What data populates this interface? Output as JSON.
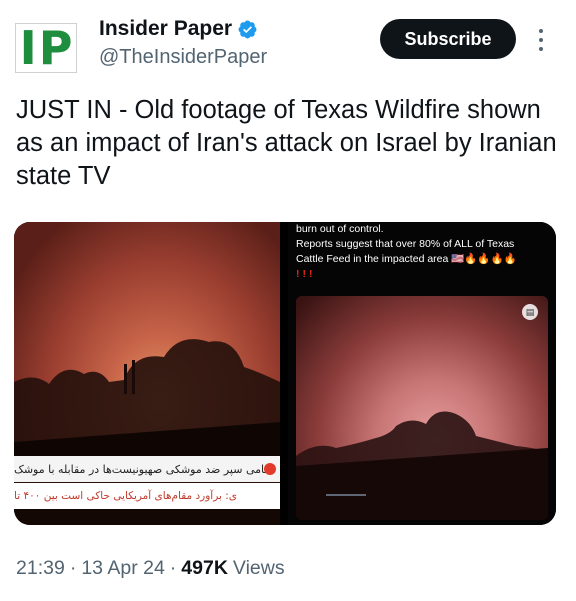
{
  "account": {
    "display_name": "Insider Paper",
    "handle": "@TheInsiderPaper",
    "logo_text": "IP",
    "verified": true
  },
  "header": {
    "subscribe_label": "Subscribe"
  },
  "tweet": {
    "text": "JUST IN - Old footage of Texas Wildfire shown as an impact of Iran's attack on Israel by Iranian state TV"
  },
  "media": {
    "left_caption_line1": "ناکامی سپر ضد موشکی صهیونیست‌ها در مقابله با موشک",
    "left_caption_line2": "ی: برآورد مقام‌های آمریکایی حاکی است بین ۴۰۰ تا",
    "right_text_line1": "burn out of control.",
    "right_text_line2": "Reports suggest that over 80% of ALL of Texas",
    "right_text_line3": "Cattle Feed in the impacted area",
    "right_text_emoji": "🇺🇸🔥🔥🔥🔥",
    "right_text_exclaim": "!!!"
  },
  "meta": {
    "time": "21:39",
    "date": "13 Apr 24",
    "views_count": "497K",
    "views_label": "Views"
  },
  "colors": {
    "brand_green": "#1e8e3e",
    "verified_blue": "#1d9bf0",
    "subscribe_bg": "#0f1419",
    "secondary_text": "#536471"
  },
  "icons": {
    "verified": "verified-badge-icon",
    "more": "more-options-icon"
  }
}
